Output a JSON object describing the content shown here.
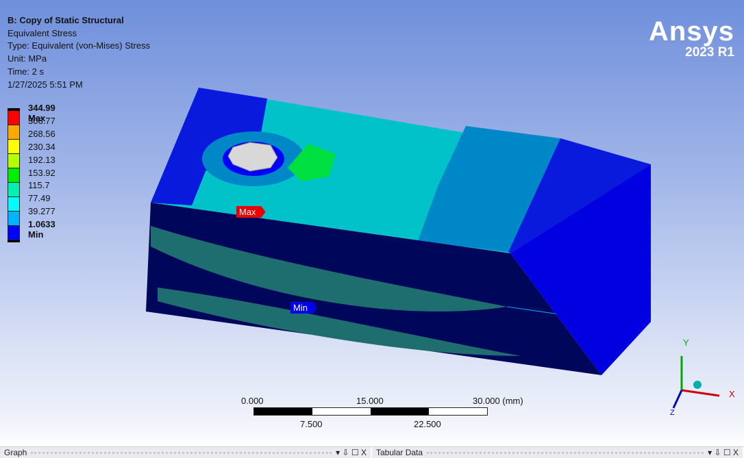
{
  "info": {
    "title": "B: Copy of Static Structural",
    "result": "Equivalent Stress",
    "type": "Type: Equivalent (von-Mises) Stress",
    "unit": "Unit: MPa",
    "time": "Time: 2 s",
    "date": "1/27/2025 5:51 PM"
  },
  "legend": {
    "labels": [
      "344.99 Max",
      "306.77",
      "268.56",
      "230.34",
      "192.13",
      "153.92",
      "115.7",
      "77.49",
      "39.277",
      "1.0633 Min"
    ],
    "colors": [
      "#ff0000",
      "#ffaa00",
      "#ffff00",
      "#b4ff00",
      "#00ee00",
      "#00f0b0",
      "#00ffff",
      "#00b4ff",
      "#0000ff"
    ]
  },
  "logo": {
    "brand": "Ansys",
    "version": "2023 R1"
  },
  "probes": {
    "max": "Max",
    "min": "Min"
  },
  "scale_bar": {
    "top": [
      "0.000",
      "15.000",
      "30.000 (mm)"
    ],
    "bottom": [
      "7.500",
      "22.500"
    ]
  },
  "triad": {
    "x": "X",
    "y": "Y",
    "z": "Z"
  },
  "panels": {
    "graph": "Graph",
    "tabular": "Tabular Data",
    "controls": "▾ ⇩ ☐ X"
  }
}
